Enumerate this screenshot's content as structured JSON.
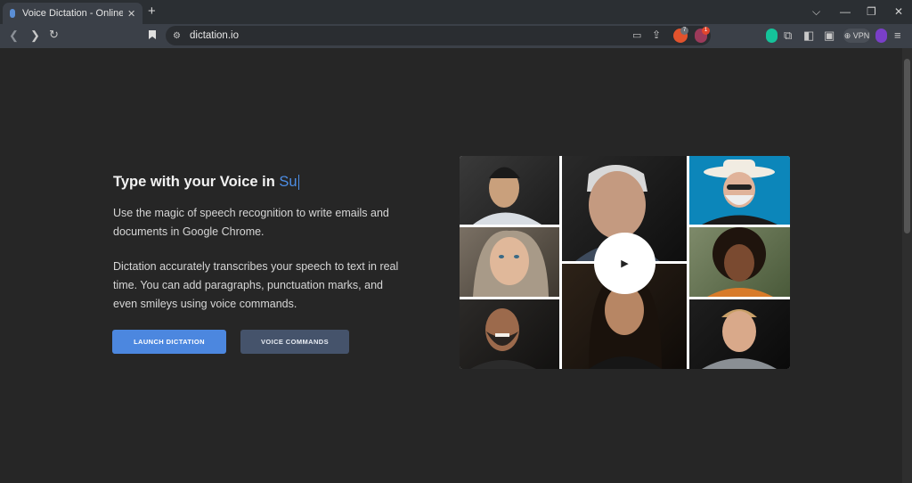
{
  "browser": {
    "tab_title": "Voice Dictation - Online Speech",
    "url": "dictation.io",
    "vpn_label": "VPN",
    "brave_badge": "7",
    "alert_badge": "1"
  },
  "hero": {
    "title": "Type with your Voice in ",
    "typed": "Su",
    "paragraph1_line1": "Use the magic of speech recognition to write emails and",
    "paragraph1_line2": "documents in Google Chrome.",
    "paragraph2_line1": "Dictation accurately transcribes your speech to text in real",
    "paragraph2_line2": "time. You can add paragraphs, punctuation marks, and",
    "paragraph2_line3": "even smileys using voice commands.",
    "launch_button": "LAUNCH DICTATION",
    "commands_button": "VOICE COMMANDS"
  },
  "video": {
    "play_icon": "play-icon"
  },
  "colors": {
    "page_bg": "#262626",
    "accent": "#4c87df",
    "secondary_button": "#45536b",
    "typed_text": "#4d8ee6"
  }
}
